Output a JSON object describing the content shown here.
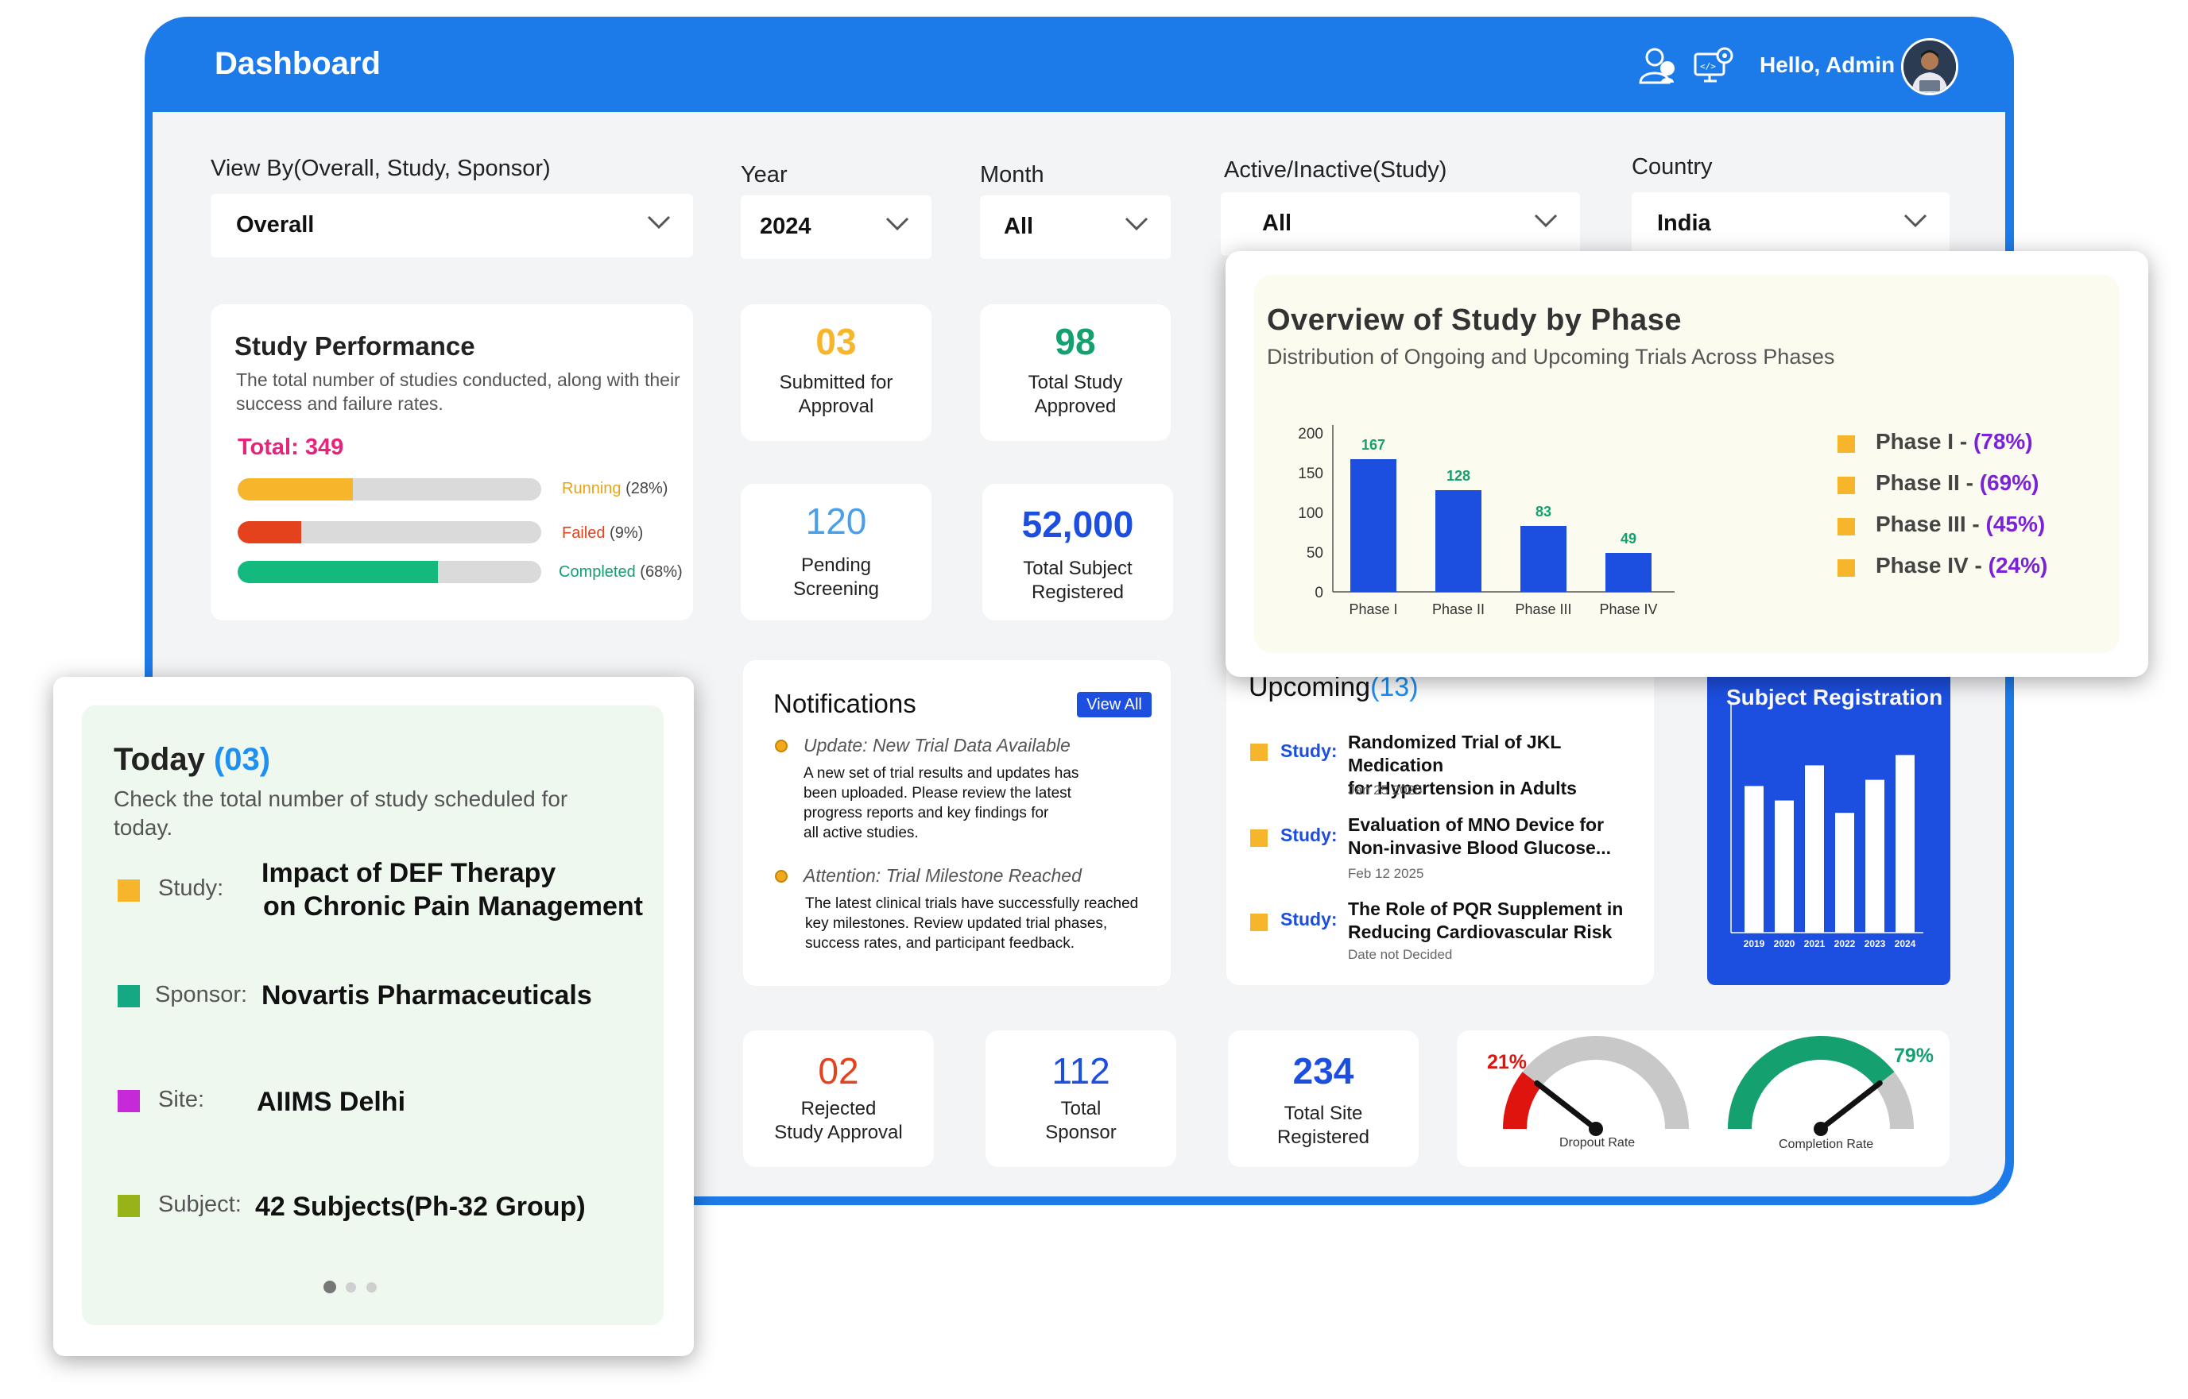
{
  "header": {
    "title": "Dashboard",
    "greeting": "Hello, Admin"
  },
  "filters": {
    "view_by": {
      "label": "View By(Overall, Study, Sponsor)",
      "value": "Overall"
    },
    "year": {
      "label": "Year",
      "value": "2024"
    },
    "month": {
      "label": "Month",
      "value": "All"
    },
    "active": {
      "label": "Active/Inactive(Study)",
      "value": "All"
    },
    "country": {
      "label": "Country",
      "value": "India"
    }
  },
  "study_performance": {
    "title": "Study Performance",
    "description": "The total number of studies conducted, along with their success and failure rates.",
    "total": "Total: 349",
    "bars": [
      {
        "label": "Running",
        "pct": "(28%)",
        "value": 0.38,
        "color": "#f7b52b"
      },
      {
        "label": "Failed",
        "pct": "(9%)",
        "value": 0.21,
        "color": "#e3421c"
      },
      {
        "label": "Completed",
        "pct": "(68%)",
        "value": 0.66,
        "color": "#14b97e"
      }
    ]
  },
  "stats": {
    "submitted": {
      "value": "03",
      "line1": "Submitted for",
      "line2": "Approval",
      "color": "#f7b52b"
    },
    "approved": {
      "value": "98",
      "line1": "Total Study",
      "line2": "Approved",
      "color": "#14a06f"
    },
    "pending": {
      "value": "120",
      "line1": "Pending",
      "line2": "Screening",
      "color": "#4aa0e8"
    },
    "subjects": {
      "value": "52,000",
      "line1": "Total Subject",
      "line2": "Registered",
      "color": "#1c4fe0"
    },
    "rejected": {
      "value": "02",
      "line1": "Rejected",
      "line2": "Study Approval",
      "color": "#e3421c"
    },
    "sponsor": {
      "value": "112",
      "line1": "Total",
      "line2": "Sponsor",
      "color": "#1c4fe0"
    },
    "site": {
      "value": "234",
      "line1": "Total Site",
      "line2": "Registered",
      "color": "#1c4fe0"
    }
  },
  "notifications": {
    "title": "Notifications",
    "view_all": "View All",
    "items": [
      {
        "head": "Update: New Trial Data Available",
        "l1": "A new set of trial results and updates has",
        "l2": "been uploaded. Please review the latest",
        "l3": "progress reports and key findings for",
        "l4": "all active studies."
      },
      {
        "head": "Attention: Trial Milestone Reached",
        "l1": "The latest clinical trials have successfully reached",
        "l2": "key milestones. Review updated trial phases,",
        "l3": "success rates, and participant feedback.",
        "l4": ""
      }
    ]
  },
  "upcoming": {
    "title": "Upcoming",
    "count": "(13)",
    "items": [
      {
        "key": "Study:",
        "l1": "Randomized Trial of JKL Medication",
        "l2": "for Hypertension in Adults",
        "date": "Jan 25 2025"
      },
      {
        "key": "Study:",
        "l1": "Evaluation of MNO Device for",
        "l2": "Non-invasive Blood Glucose...",
        "date": "Feb 12 2025"
      },
      {
        "key": "Study:",
        "l1": "The Role of PQR Supplement in",
        "l2": "Reducing Cardiovascular Risk",
        "date": "Date not Decided"
      }
    ]
  },
  "subject_registration": {
    "title": "Subject Registration",
    "chart_data": {
      "type": "bar",
      "categories": [
        "2019",
        "2020",
        "2021",
        "2022",
        "2023",
        "2024"
      ],
      "values": [
        0.71,
        0.64,
        0.81,
        0.58,
        0.74,
        0.86
      ],
      "title": "Subject Registration"
    }
  },
  "gauges": [
    {
      "pct": "21%",
      "label": "Dropout Rate",
      "value": 0.21,
      "color": "#e0140e"
    },
    {
      "pct": "79%",
      "label": "Completion Rate",
      "value": 0.79,
      "color": "#14a06f"
    }
  ],
  "overview": {
    "title": "Overview of Study by Phase",
    "subtitle": "Distribution of Ongoing and Upcoming Trials Across Phases",
    "legend": [
      {
        "name": "Phase I - ",
        "pct": "(78%)"
      },
      {
        "name": "Phase II - ",
        "pct": "(69%)"
      },
      {
        "name": "Phase III - ",
        "pct": "(45%)"
      },
      {
        "name": "Phase IV - ",
        "pct": "(24%)"
      }
    ],
    "chart_data": {
      "type": "bar",
      "categories": [
        "Phase I",
        "Phase II",
        "Phase III",
        "Phase IV"
      ],
      "values": [
        167,
        128,
        83,
        49
      ],
      "ylim": [
        0,
        200
      ],
      "yticks": [
        0,
        50,
        100,
        150,
        200
      ],
      "bar_color": "#1c4fe0"
    }
  },
  "today": {
    "title": "Today",
    "count": "(03)",
    "description": "Check the total number of study scheduled for today.",
    "study_key": "Study:",
    "study_l1": "Impact of DEF Therapy",
    "study_l2": "on Chronic Pain Management",
    "sponsor_key": "Sponsor:",
    "sponsor": "Novartis Pharmaceuticals",
    "site_key": "Site:",
    "site": "AIIMS Delhi",
    "subject_key": "Subject:",
    "subject": "42 Subjects(Ph-32 Group)"
  },
  "colors": {
    "brand": "#1c7be9",
    "accent": "#1c4fe0"
  }
}
